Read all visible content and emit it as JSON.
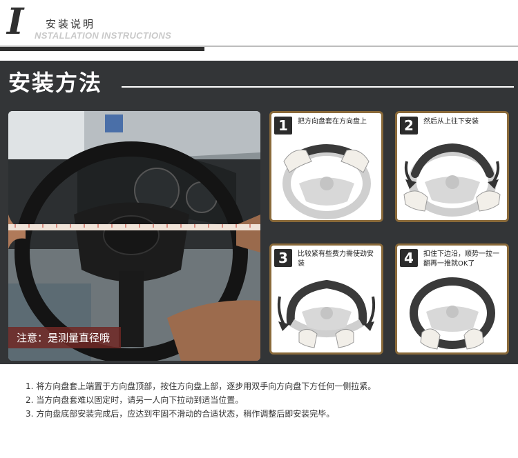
{
  "header": {
    "letter": "I",
    "title_cn": "安装说明",
    "title_en": "NSTALLATION INSTRUCTIONS"
  },
  "section_title": "安装方法",
  "photo": {
    "note": "注意：是测量直径哦"
  },
  "steps": [
    {
      "number": "1",
      "text": "把方向盘套在方向盘上"
    },
    {
      "number": "2",
      "text": "然后从上往下安装"
    },
    {
      "number": "3",
      "text": "比较紧有些费力需使劲安装"
    },
    {
      "number": "4",
      "text": "扣住下边沿，顺势一拉一翻再一推就OK了"
    }
  ],
  "instructions": [
    "1. 将方向盘套上端置于方向盘顶部，按住方向盘上部，逐步用双手向方向盘下方任何一侧拉紧。",
    "2. 当方向盘套难以固定时，请另一人向下拉动到适当位置。",
    "3. 方向盘底部安装完成后，应达到牢固不滑动的合适状态，稍作调整后即安装完毕。"
  ]
}
